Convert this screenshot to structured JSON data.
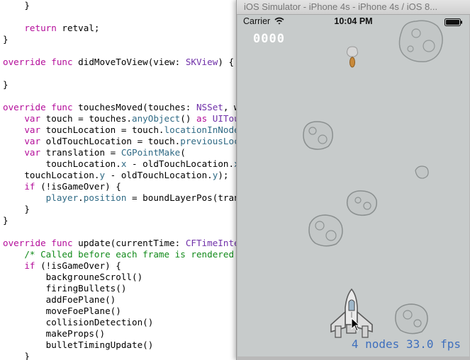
{
  "editor": {
    "lines": [
      {
        "indent": "    ",
        "tokens": [
          {
            "t": "}",
            "c": "plain"
          }
        ]
      },
      {
        "indent": "",
        "tokens": []
      },
      {
        "indent": "    ",
        "tokens": [
          {
            "t": "return",
            "c": "kw"
          },
          {
            "t": " retval;",
            "c": "plain"
          }
        ]
      },
      {
        "indent": "",
        "tokens": [
          {
            "t": "}",
            "c": "plain"
          }
        ]
      },
      {
        "indent": "",
        "tokens": []
      },
      {
        "indent": "",
        "tokens": [
          {
            "t": "override func",
            "c": "kw"
          },
          {
            "t": " didMoveToView(view: ",
            "c": "plain"
          },
          {
            "t": "SKView",
            "c": "type"
          },
          {
            "t": ") {",
            "c": "plain"
          }
        ]
      },
      {
        "indent": "",
        "tokens": []
      },
      {
        "indent": "",
        "tokens": [
          {
            "t": "}",
            "c": "plain"
          }
        ]
      },
      {
        "indent": "",
        "tokens": []
      },
      {
        "indent": "",
        "tokens": [
          {
            "t": "override func",
            "c": "kw"
          },
          {
            "t": " touchesMoved(touches: ",
            "c": "plain"
          },
          {
            "t": "NSSet",
            "c": "type"
          },
          {
            "t": ", wit",
            "c": "plain"
          }
        ]
      },
      {
        "indent": "    ",
        "tokens": [
          {
            "t": "var",
            "c": "kw"
          },
          {
            "t": " touch = touches.",
            "c": "plain"
          },
          {
            "t": "anyObject",
            "c": "member"
          },
          {
            "t": "() ",
            "c": "plain"
          },
          {
            "t": "as",
            "c": "kw"
          },
          {
            "t": " ",
            "c": "plain"
          },
          {
            "t": "UITouch",
            "c": "type"
          }
        ]
      },
      {
        "indent": "    ",
        "tokens": [
          {
            "t": "var",
            "c": "kw"
          },
          {
            "t": " touchLocation = touch.",
            "c": "plain"
          },
          {
            "t": "locationInNode",
            "c": "member"
          },
          {
            "t": "(s",
            "c": "plain"
          }
        ]
      },
      {
        "indent": "    ",
        "tokens": [
          {
            "t": "var",
            "c": "kw"
          },
          {
            "t": " oldTouchLocation = touch.",
            "c": "plain"
          },
          {
            "t": "previousLocat",
            "c": "member"
          }
        ]
      },
      {
        "indent": "    ",
        "tokens": [
          {
            "t": "var",
            "c": "kw"
          },
          {
            "t": " translation = ",
            "c": "plain"
          },
          {
            "t": "CGPointMake",
            "c": "member"
          },
          {
            "t": "(",
            "c": "plain"
          }
        ]
      },
      {
        "indent": "        ",
        "tokens": [
          {
            "t": "touchLocation.",
            "c": "plain"
          },
          {
            "t": "x",
            "c": "member"
          },
          {
            "t": " - oldTouchLocation.",
            "c": "plain"
          },
          {
            "t": "x",
            "c": "member"
          },
          {
            "t": ",",
            "c": "plain"
          }
        ]
      },
      {
        "indent": "    ",
        "tokens": [
          {
            "t": "touchLocation.",
            "c": "plain"
          },
          {
            "t": "y",
            "c": "member"
          },
          {
            "t": " - oldTouchLocation.",
            "c": "plain"
          },
          {
            "t": "y",
            "c": "member"
          },
          {
            "t": ");",
            "c": "plain"
          }
        ]
      },
      {
        "indent": "    ",
        "tokens": [
          {
            "t": "if",
            "c": "kw"
          },
          {
            "t": " (!isGameOver) {",
            "c": "plain"
          }
        ]
      },
      {
        "indent": "        ",
        "tokens": [
          {
            "t": "player",
            "c": "member"
          },
          {
            "t": ".",
            "c": "plain"
          },
          {
            "t": "position",
            "c": "member"
          },
          {
            "t": " = boundLayerPos(transl",
            "c": "plain"
          }
        ]
      },
      {
        "indent": "    ",
        "tokens": [
          {
            "t": "}",
            "c": "plain"
          }
        ]
      },
      {
        "indent": "",
        "tokens": [
          {
            "t": "}",
            "c": "plain"
          }
        ]
      },
      {
        "indent": "",
        "tokens": []
      },
      {
        "indent": "",
        "tokens": [
          {
            "t": "override func",
            "c": "kw"
          },
          {
            "t": " update(currentTime: ",
            "c": "plain"
          },
          {
            "t": "CFTimeInterv",
            "c": "type"
          }
        ]
      },
      {
        "indent": "    ",
        "tokens": [
          {
            "t": "/* Called before each frame is rendered */",
            "c": "comment"
          }
        ]
      },
      {
        "indent": "    ",
        "tokens": [
          {
            "t": "if",
            "c": "kw"
          },
          {
            "t": " (!isGameOver) {",
            "c": "plain"
          }
        ]
      },
      {
        "indent": "        ",
        "tokens": [
          {
            "t": "backgrouneScroll()",
            "c": "plain"
          }
        ]
      },
      {
        "indent": "        ",
        "tokens": [
          {
            "t": "firingBullets()",
            "c": "plain"
          }
        ]
      },
      {
        "indent": "        ",
        "tokens": [
          {
            "t": "addFoePlane()",
            "c": "plain"
          }
        ]
      },
      {
        "indent": "        ",
        "tokens": [
          {
            "t": "moveFoePlane()",
            "c": "plain"
          }
        ]
      },
      {
        "indent": "        ",
        "tokens": [
          {
            "t": "collisionDetection()",
            "c": "plain"
          }
        ]
      },
      {
        "indent": "        ",
        "tokens": [
          {
            "t": "makeProps()",
            "c": "plain"
          }
        ]
      },
      {
        "indent": "        ",
        "tokens": [
          {
            "t": "bulletTimingUpdate()",
            "c": "plain"
          }
        ]
      },
      {
        "indent": "    ",
        "tokens": [
          {
            "t": "}",
            "c": "plain"
          }
        ]
      }
    ]
  },
  "simulator": {
    "title": "iOS Simulator - iPhone 4s - iPhone 4s / iOS 8...",
    "status": {
      "carrier": "Carrier",
      "time": "10:04 PM"
    },
    "game": {
      "score": "0000",
      "stats": "4 nodes  33.0 fps"
    }
  },
  "colors": {
    "keyword": "#b40d9a",
    "type": "#6f2fa8",
    "member": "#2f6a85",
    "comment": "#118a1a",
    "game_background": "#c7cbcb",
    "stats_text": "#3e6fbd"
  },
  "icons": [
    "wifi-icon",
    "battery-icon",
    "asteroid-icon",
    "foe-plane-icon",
    "player-ship-icon",
    "cursor-icon"
  ]
}
